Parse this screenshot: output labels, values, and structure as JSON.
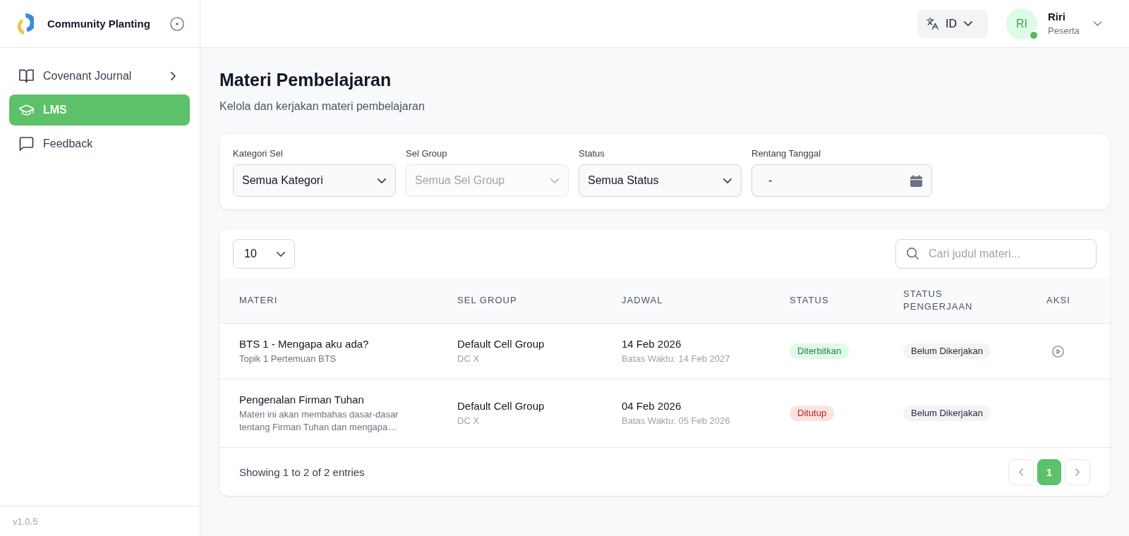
{
  "sidebar": {
    "brand": "Community Planting",
    "items": [
      {
        "label": "Covenant Journal",
        "kind": "group",
        "selected": false
      },
      {
        "label": "LMS",
        "kind": "link",
        "selected": true
      },
      {
        "label": "Feedback",
        "kind": "link",
        "selected": false
      }
    ],
    "version": "v1.0.5"
  },
  "topbar": {
    "language": "ID",
    "user": {
      "initials": "RI",
      "name": "Riri",
      "role": "Peserta",
      "online": true
    }
  },
  "page": {
    "title": "Materi Pembelajaran",
    "subtitle": "Kelola dan kerjakan materi pembelajaran"
  },
  "filters": [
    {
      "label": "Kategori Sel",
      "value": "Semua Kategori",
      "kind": "select",
      "disabled": false
    },
    {
      "label": "Sel Group",
      "value": "Semua Sel Group",
      "kind": "select",
      "disabled": true
    },
    {
      "label": "Status",
      "value": "Semua Status",
      "kind": "select",
      "disabled": false
    },
    {
      "label": "Rentang Tanggal",
      "value": "-",
      "kind": "date",
      "disabled": false
    }
  ],
  "table": {
    "page_size": "10",
    "search": {
      "placeholder": "Cari judul materi..."
    },
    "columns": [
      "MATERI",
      "SEL GROUP",
      "JADWAL",
      "STATUS",
      "STATUS PENGERJAAN",
      "AKSI"
    ],
    "rows": [
      {
        "title": "BTS 1 - Mengapa aku ada?",
        "description": "Topik 1 Pertemuan BTS",
        "group": "Default Cell Group",
        "group_code": "DC X",
        "date": "14 Feb 2026",
        "deadline": "Batas Waktu: 14 Feb 2027",
        "status": {
          "label": "Diterbitkan",
          "kind": "published"
        },
        "progress": "Belum Dikerjakan",
        "playable": true
      },
      {
        "title": "Pengenalan Firman Tuhan",
        "description": "Materi ini akan membahas dasar-dasar tentang Firman Tuhan dan mengapa…",
        "group": "Default Cell Group",
        "group_code": "DC X",
        "date": "04 Feb 2026",
        "deadline": "Batas Waktu: 05 Feb 2026",
        "status": {
          "label": "Ditutup",
          "kind": "closed"
        },
        "progress": "Belum Dikerjakan",
        "playable": false
      }
    ],
    "summary": "Showing 1 to 2 of 2 entries",
    "pages": [
      {
        "label": "1",
        "selected": true
      }
    ]
  }
}
